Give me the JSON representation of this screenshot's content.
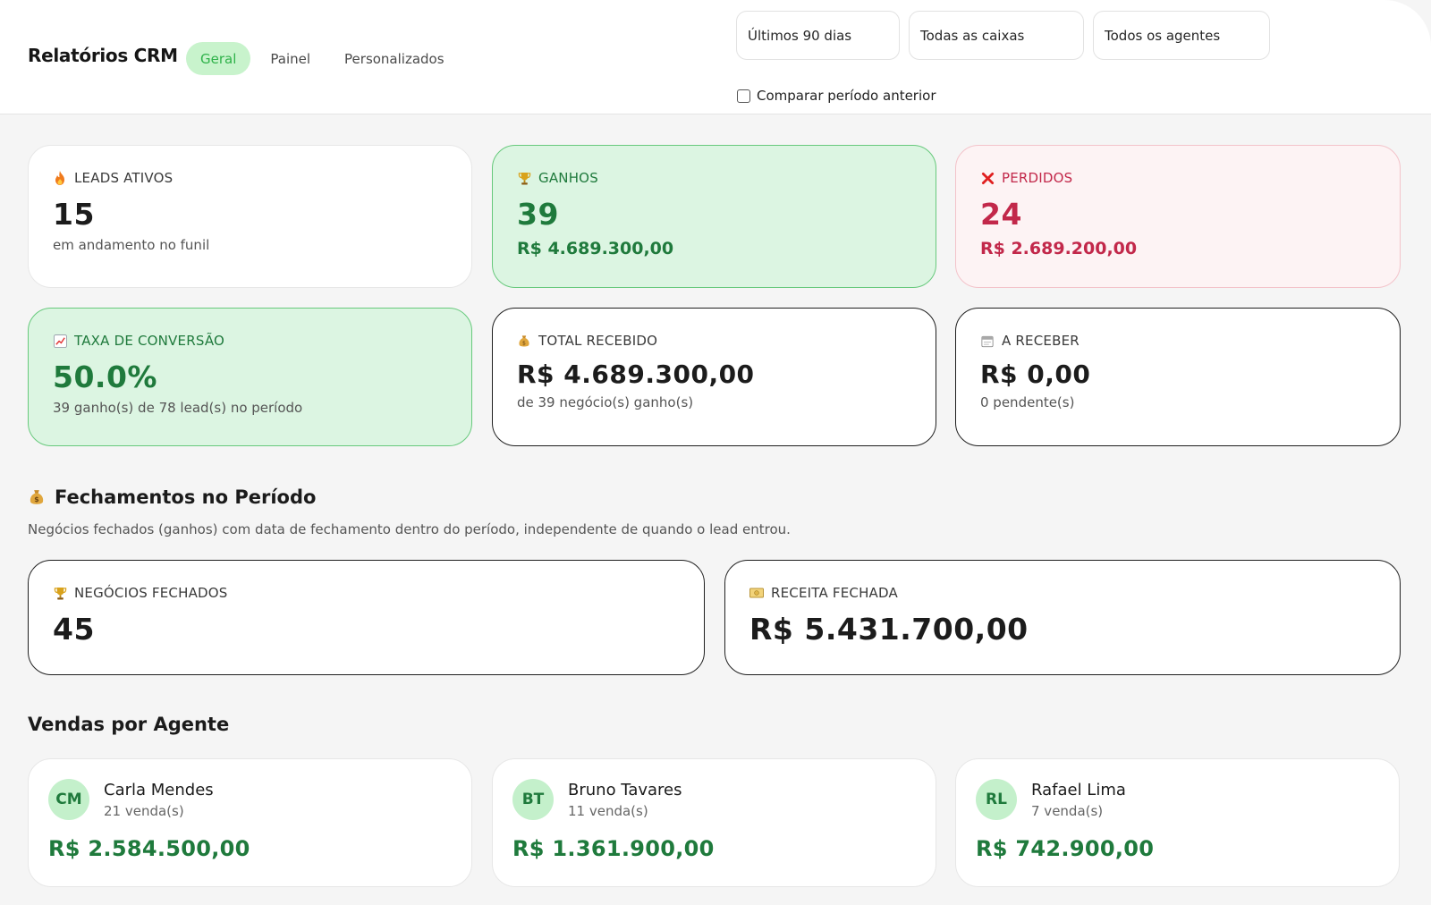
{
  "header": {
    "title": "Relatórios CRM",
    "tabs": [
      {
        "label": "Geral",
        "active": true
      },
      {
        "label": "Painel",
        "active": false
      },
      {
        "label": "Personalizados",
        "active": false
      }
    ],
    "filters": {
      "period": "Últimos 90 dias",
      "inbox": "Todas as caixas",
      "agent": "Todos os agentes"
    },
    "compare_label": "Comparar período anterior",
    "compare_checked": false
  },
  "kpis": {
    "leads": {
      "icon": "fire-icon",
      "label": "LEADS ATIVOS",
      "value": "15",
      "sub": "em andamento no funil"
    },
    "ganhos": {
      "icon": "trophy-icon",
      "label": "GANHOS",
      "value": "39",
      "sub": "R$ 4.689.300,00"
    },
    "perdidos": {
      "icon": "close-icon",
      "label": "PERDIDOS",
      "value": "24",
      "sub": "R$ 2.689.200,00"
    },
    "conversao": {
      "icon": "chart-up-icon",
      "label": "TAXA DE CONVERSÃO",
      "value": "50.0%",
      "sub": "39 ganho(s) de 78 lead(s) no período"
    },
    "recebido": {
      "icon": "money-bag-icon",
      "label": "TOTAL RECEBIDO",
      "value": "R$ 4.689.300,00",
      "sub": "de 39 negócio(s) ganho(s)"
    },
    "receber": {
      "icon": "calendar-icon",
      "label": "A RECEBER",
      "value": "R$ 0,00",
      "sub": "0 pendente(s)"
    }
  },
  "closings": {
    "icon": "money-bag-icon",
    "title": "Fechamentos no Período",
    "description": "Negócios fechados (ganhos) com data de fechamento dentro do período, independente de quando o lead entrou.",
    "deals": {
      "icon": "trophy-icon",
      "label": "NEGÓCIOS FECHADOS",
      "value": "45"
    },
    "revenue": {
      "icon": "banknote-icon",
      "label": "RECEITA FECHADA",
      "value": "R$ 5.431.700,00"
    }
  },
  "agents": {
    "title": "Vendas por Agente",
    "items": [
      {
        "initials": "CM",
        "name": "Carla Mendes",
        "sales": "21 venda(s)",
        "total": "R$ 2.584.500,00"
      },
      {
        "initials": "BT",
        "name": "Bruno Tavares",
        "sales": "11 venda(s)",
        "total": "R$ 1.361.900,00"
      },
      {
        "initials": "RL",
        "name": "Rafael Lima",
        "sales": "7 venda(s)",
        "total": "R$ 742.900,00"
      }
    ]
  },
  "colors": {
    "accent_green": "#1f7a3c",
    "tab_active_bg": "#c8f3cc",
    "loss_red": "#c2284a",
    "avatar_bg": "#c4f0cb"
  }
}
